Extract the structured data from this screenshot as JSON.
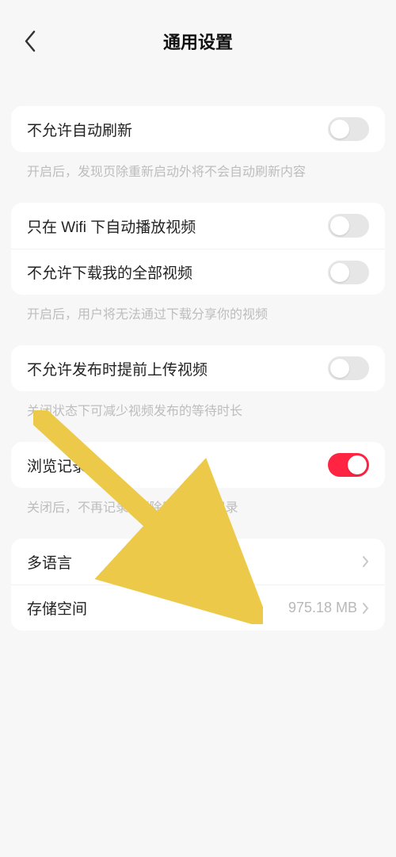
{
  "header": {
    "title": "通用设置"
  },
  "rows": {
    "autoRefresh": {
      "label": "不允许自动刷新",
      "desc": "开启后，发现页除重新启动外将不会自动刷新内容",
      "on": false
    },
    "wifiAutoplay": {
      "label": "只在 Wifi 下自动播放视频",
      "on": false
    },
    "downloadAll": {
      "label": "不允许下载我的全部视频",
      "desc": "开启后，用户将无法通过下载分享你的视频",
      "on": false
    },
    "preupload": {
      "label": "不允许发布时提前上传视频",
      "desc": "关闭状态下可减少视频发布的等待时长",
      "on": false
    },
    "history": {
      "label": "浏览记录",
      "desc": "关闭后，不再记录··删除历史浏览记录",
      "on": true
    },
    "language": {
      "label": "多语言"
    },
    "storage": {
      "label": "存储空间",
      "value": "975.18 MB"
    }
  }
}
